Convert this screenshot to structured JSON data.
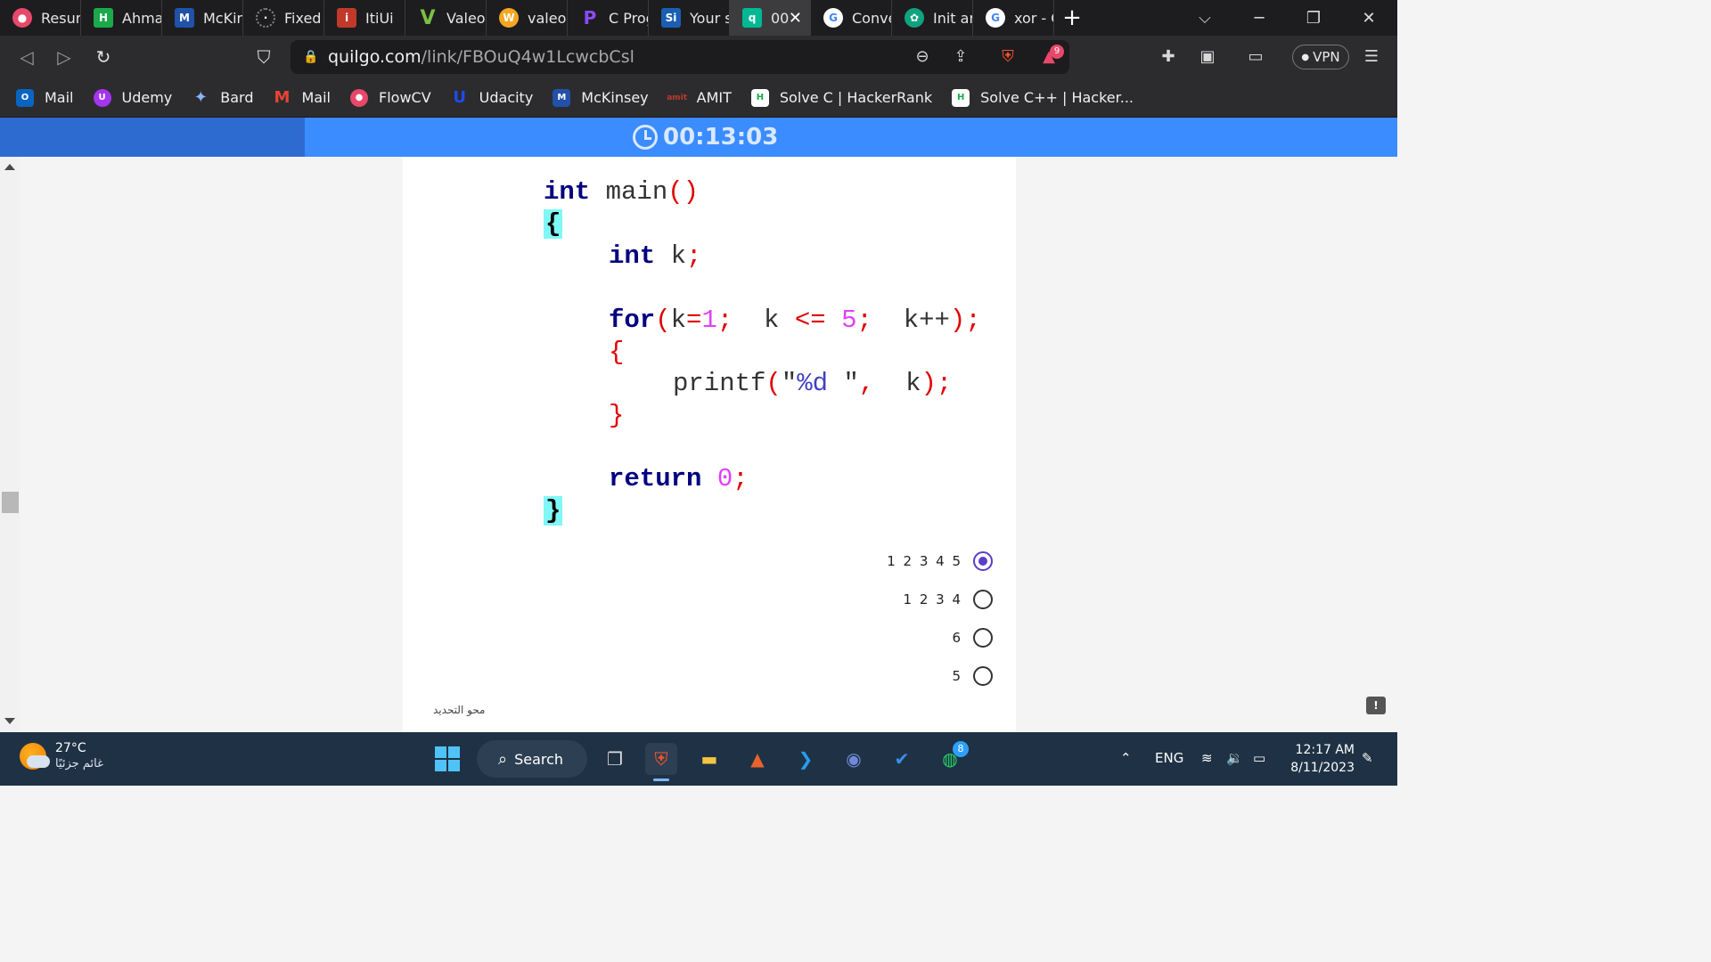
{
  "browser": {
    "tabs": [
      {
        "title": "Resum",
        "icon": "brave-red-icon",
        "color": "#e8486a"
      },
      {
        "title": "Ahmad",
        "icon": "hackerrank-icon",
        "color": "#1ba94c"
      },
      {
        "title": "McKin",
        "icon": "mckinsey-icon",
        "color": "#2151a8"
      },
      {
        "title": "Fixed",
        "icon": "dotted-circle-icon",
        "color": "#666666"
      },
      {
        "title": "ItiUi",
        "icon": "iti-icon",
        "color": "#c0392b"
      },
      {
        "title": "Valeo",
        "icon": "valeo-v-icon",
        "color": "#7bc043"
      },
      {
        "title": "valeo.",
        "icon": "wifi-w-icon",
        "color": "#f5a623"
      },
      {
        "title": "C Prog",
        "icon": "p-icon",
        "color": "#6a1bd3"
      },
      {
        "title": "Your s",
        "icon": "si-icon",
        "color": "#1a5fb4"
      },
      {
        "title": "00",
        "icon": "quilgo-q-icon",
        "color": "#00b894"
      },
      {
        "title": "Conve",
        "icon": "google-g-icon",
        "color": "#4285f4"
      },
      {
        "title": "Init ar",
        "icon": "chatgpt-icon",
        "color": "#10a37f"
      },
      {
        "title": "xor - C",
        "icon": "google-g-icon",
        "color": "#4285f4"
      }
    ],
    "active_tab_index": 9,
    "url_host": "quilgo.com",
    "url_path": "/link/FBOuQ4w1LcwcbCsl",
    "brave_rewards_count": "9",
    "vpn_label": "VPN",
    "bookmarks": [
      {
        "label": "Mail",
        "icon": "outlook-icon",
        "color": "#0a64c2"
      },
      {
        "label": "Udemy",
        "icon": "udemy-icon",
        "color": "#a435f0"
      },
      {
        "label": "Bard",
        "icon": "bard-sparkle-icon",
        "color": "#6a7cf0"
      },
      {
        "label": "Mail",
        "icon": "gmail-icon",
        "color": "#ea4335"
      },
      {
        "label": "FlowCV",
        "icon": "flowcv-icon",
        "color": "#e8486a"
      },
      {
        "label": "Udacity",
        "icon": "udacity-icon",
        "color": "#1d4bf0"
      },
      {
        "label": "McKinsey",
        "icon": "mckinsey-icon",
        "color": "#2151a8"
      },
      {
        "label": "AMIT",
        "icon": "amit-icon",
        "color": "#c0392b"
      },
      {
        "label": "Solve C | HackerRank",
        "icon": "hackerrank-icon",
        "color": "#1ba94c"
      },
      {
        "label": "Solve C++ | Hacker...",
        "icon": "hackerrank-icon",
        "color": "#1ba94c"
      }
    ]
  },
  "quiz": {
    "timer": "00:13:03",
    "code_lines": {
      "l1_kw": "int",
      "l1_rest": " main",
      "l1_paren": "()",
      "l2": "{",
      "l3_kw": "int",
      "l3_rest": " k",
      "l3_semi": ";",
      "l4_kw": "for",
      "l4_a": "(",
      "l4_b": "k",
      "l4_c": "=",
      "l4_d": "1",
      "l4_e": ";",
      "l4_f": "  k ",
      "l4_g": "<=",
      "l4_h": " ",
      "l4_i": "5",
      "l4_j": ";",
      "l4_k": "  k++",
      "l4_l": ");",
      "l5": "{",
      "l6_fn": "printf",
      "l6_a": "(",
      "l6_b": "\"",
      "l6_c": "%d",
      "l6_d": " \"",
      "l6_e": ",",
      "l6_f": "  k",
      "l6_g": ");",
      "l7": "}",
      "l8_kw": "return",
      "l8_sp": " ",
      "l8_num": "0",
      "l8_semi": ";",
      "l9": "}"
    },
    "options": [
      {
        "label": "1 2 3 4 5",
        "selected": true
      },
      {
        "label": "1 2 3 4",
        "selected": false
      },
      {
        "label": "6",
        "selected": false
      },
      {
        "label": "5",
        "selected": false
      }
    ],
    "clear_selection_label": "محو التحديد"
  },
  "taskbar": {
    "temperature": "27°C",
    "condition": "غائم جزئيًا",
    "search_label": "Search",
    "language": "ENG",
    "time": "12:17 AM",
    "date": "8/11/2023",
    "whatsapp_badge": "8"
  }
}
